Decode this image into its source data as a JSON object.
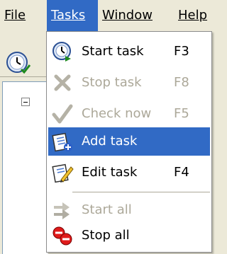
{
  "menubar": {
    "items": [
      {
        "label": "File",
        "active": false
      },
      {
        "label": "Tasks",
        "active": true
      },
      {
        "label": "Window",
        "active": false
      },
      {
        "label": "Help",
        "active": false
      }
    ]
  },
  "toolbar": {
    "button_icon": "clock-check-icon"
  },
  "tree": {
    "expander": "collapse-minus-icon"
  },
  "tasks_menu": {
    "items": [
      {
        "label": "Start task",
        "shortcut": "F3",
        "icon": "clock-play-icon",
        "enabled": true
      },
      {
        "label": "Stop task",
        "shortcut": "F8",
        "icon": "x-icon",
        "enabled": false
      },
      {
        "label": "Check now",
        "shortcut": "F5",
        "icon": "checkmark-icon",
        "enabled": false
      },
      {
        "label": "Add task",
        "shortcut": "",
        "icon": "add-task-icon",
        "enabled": true,
        "highlighted": true
      },
      {
        "label": "Edit task",
        "shortcut": "F4",
        "icon": "edit-task-icon",
        "enabled": true
      },
      {
        "label": "Start all",
        "shortcut": "",
        "icon": "start-all-arrows-icon",
        "enabled": false
      },
      {
        "label": "Stop all",
        "shortcut": "",
        "icon": "stop-all-icon",
        "enabled": true
      }
    ]
  },
  "colors": {
    "menu_background": "#ece9d8",
    "highlight": "#316ac5",
    "disabled_text": "#aca899"
  }
}
